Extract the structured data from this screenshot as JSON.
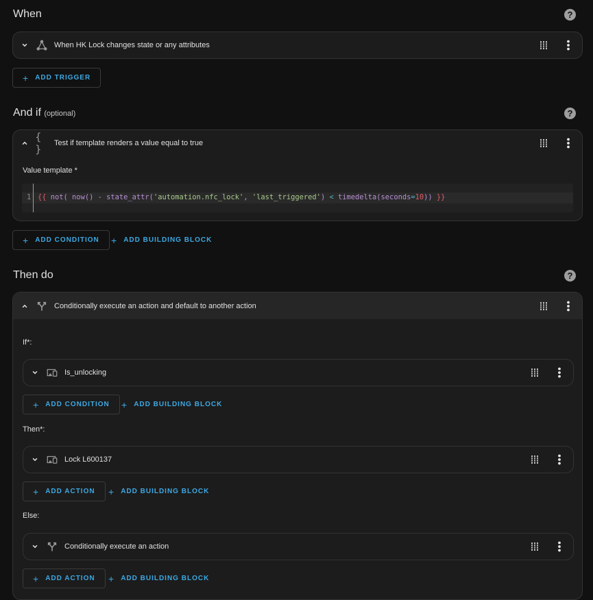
{
  "when": {
    "title": "When",
    "trigger": {
      "label": "When HK Lock changes state or any attributes",
      "icon": "state-trigger-icon"
    },
    "add_trigger_label": "ADD TRIGGER"
  },
  "and_if": {
    "title": "And if",
    "optional": "(optional)",
    "condition": {
      "label": "Test if template renders a value equal to true",
      "icon": "template-braces-icon",
      "field_label": "Value template *",
      "line_number": "1",
      "code": {
        "open": "{{",
        "not": " not(",
        "now": " now()",
        "minus": " -",
        "func": " state_attr(",
        "arg1": "'automation.nfc_lock'",
        "comma": ",",
        "arg2": " 'last_triggered'",
        "close1": ")",
        "lt": " <",
        "td": " timedelta(",
        "kw": "seconds",
        "eq": "=",
        "num": "10",
        "close2": "))",
        "end": " }}"
      }
    },
    "add_condition_label": "ADD CONDITION",
    "add_building_block_label": "ADD BUILDING BLOCK"
  },
  "then_do": {
    "title": "Then do",
    "action": {
      "label": "Conditionally execute an action and default to another action",
      "icon": "choose-branch-icon",
      "if_label": "If*:",
      "if_item": {
        "label": "Is_unlocking",
        "icon": "device-icon"
      },
      "if_add_condition": "ADD CONDITION",
      "if_add_block": "ADD BUILDING BLOCK",
      "then_label": "Then*:",
      "then_item": {
        "label": "Lock L600137",
        "icon": "device-icon"
      },
      "then_add_action": "ADD ACTION",
      "then_add_block": "ADD BUILDING BLOCK",
      "else_label": "Else:",
      "else_item": {
        "label": "Conditionally execute an action",
        "icon": "choose-branch-icon"
      },
      "else_add_action": "ADD ACTION",
      "else_add_block": "ADD BUILDING BLOCK"
    }
  },
  "help_glyph": "?",
  "plus_glyph": "+",
  "colors": {
    "accent": "#3ca9e4",
    "background": "#111111",
    "card": "#1c1c1c"
  }
}
